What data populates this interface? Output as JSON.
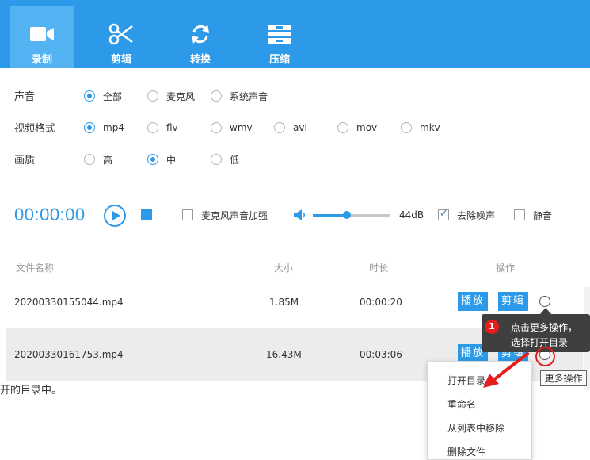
{
  "toolbar": {
    "tabs": [
      {
        "label": "录制",
        "icon": "camera-icon",
        "active": true
      },
      {
        "label": "剪辑",
        "icon": "scissors-icon",
        "active": false
      },
      {
        "label": "转换",
        "icon": "refresh-icon",
        "active": false
      },
      {
        "label": "压缩",
        "icon": "compress-icon",
        "active": false
      }
    ]
  },
  "settings": {
    "audio": {
      "label": "声音",
      "options": [
        "全部",
        "麦克风",
        "系统声音"
      ],
      "selected": "全部"
    },
    "format": {
      "label": "视频格式",
      "options": [
        "mp4",
        "flv",
        "wmv",
        "avi",
        "mov",
        "mkv"
      ],
      "selected": "mp4"
    },
    "quality": {
      "label": "画质",
      "options": [
        "高",
        "中",
        "低"
      ],
      "selected": "中"
    }
  },
  "controls": {
    "timer": "00:00:00",
    "mic_boost_label": "麦克风声音加强",
    "mic_boost_checked": false,
    "volume_db": "44dB",
    "volume_level": 0.44,
    "denoise_label": "去除噪声",
    "denoise_checked": true,
    "mute_label": "静音",
    "mute_checked": false
  },
  "file_list": {
    "columns": [
      "文件名称",
      "大小",
      "时长",
      "操作"
    ],
    "rows": [
      {
        "name": "20200330155044.mp4",
        "size": "1.85M",
        "duration": "00:00:20",
        "play": "播放",
        "edit": "剪辑"
      },
      {
        "name": "20200330161753.mp4",
        "size": "16.43M",
        "duration": "00:03:06",
        "play": "播放",
        "edit": "剪辑"
      }
    ]
  },
  "tutorial": {
    "step": "1",
    "tip_line1": "点击更多操作，",
    "tip_line2": "选择打开目录",
    "more_tooltip": "更多操作",
    "accent": "#e51d1d"
  },
  "context_menu": {
    "items": [
      "打开目录",
      "重命名",
      "从列表中移除",
      "删除文件"
    ]
  },
  "partial_text": "开的目录中。",
  "colors": {
    "brand": "#2c9ae8",
    "toolbar_active": "#52b2f2"
  }
}
